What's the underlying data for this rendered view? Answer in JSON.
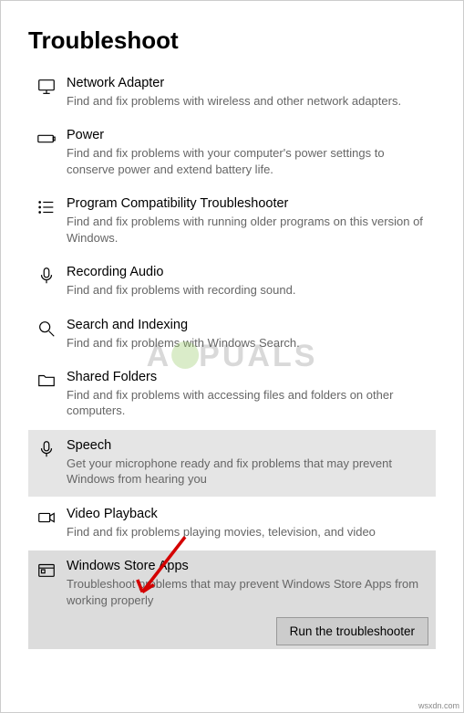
{
  "page": {
    "title": "Troubleshoot"
  },
  "items": [
    {
      "title": "Network Adapter",
      "desc": "Find and fix problems with wireless and other network adapters."
    },
    {
      "title": "Power",
      "desc": "Find and fix problems with your computer's power settings to conserve power and extend battery life."
    },
    {
      "title": "Program Compatibility Troubleshooter",
      "desc": "Find and fix problems with running older programs on this version of Windows."
    },
    {
      "title": "Recording Audio",
      "desc": "Find and fix problems with recording sound."
    },
    {
      "title": "Search and Indexing",
      "desc": "Find and fix problems with Windows Search."
    },
    {
      "title": "Shared Folders",
      "desc": "Find and fix problems with accessing files and folders on other computers."
    },
    {
      "title": "Speech",
      "desc": "Get your microphone ready and fix problems that may prevent Windows from hearing you"
    },
    {
      "title": "Video Playback",
      "desc": "Find and fix problems playing movies, television, and video"
    },
    {
      "title": "Windows Store Apps",
      "desc": "Troubleshoot problems that may prevent Windows Store Apps from working properly"
    }
  ],
  "button": {
    "run": "Run the troubleshooter"
  },
  "watermark": {
    "text_left": "A",
    "text_right": "PUALS"
  },
  "footer": {
    "text": "wsxdn.com"
  }
}
